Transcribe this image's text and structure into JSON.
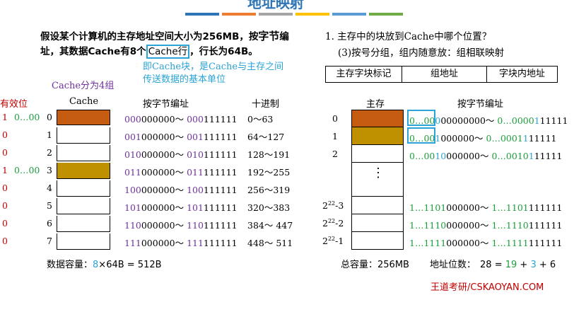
{
  "colors": {
    "brown": "#c55a11",
    "gold": "#bf9000",
    "red": "#c00000",
    "green": "#1a9e3a",
    "purple": "#7030a0",
    "blue": "#2aa3d6",
    "accent": "#2e75b6"
  },
  "slide_title": "地址映射",
  "question": {
    "line1_pre": "假设某个计算机的主存地址空间大小为256MB，按",
    "line1_bold": "字节",
    "line1_post": "编",
    "line2_pre": "址，其数据Cache有8个",
    "line2_box": "Cache行",
    "line2_post": "，行长为64B。"
  },
  "note": {
    "line1": "即Cache块，是Cache与主存之间",
    "line2": "传送数据的基本单位"
  },
  "groups_label": "Cache分为4组",
  "left_headers": {
    "valid": "有效位",
    "cache": "Cache",
    "addr": "按字节编址",
    "decimal": "十进制"
  },
  "cache_rows": [
    {
      "valid": "1",
      "tag": "0…00",
      "index": "0",
      "hi": "000",
      "lo": "000000",
      "hi2": "000",
      "lo2": "111111",
      "dec": "0～63"
    },
    {
      "valid": "0",
      "tag": "",
      "index": "1",
      "hi": "001",
      "lo": "000000",
      "hi2": "001",
      "lo2": "111111",
      "dec": "64～127"
    },
    {
      "valid": "0",
      "tag": "",
      "index": "2",
      "hi": "010",
      "lo": "000000",
      "hi2": "010",
      "lo2": "111111",
      "dec": "128～191"
    },
    {
      "valid": "1",
      "tag": "0…00",
      "index": "3",
      "hi": "011",
      "lo": "000000",
      "hi2": "011",
      "lo2": "111111",
      "dec": "192～255"
    },
    {
      "valid": "0",
      "tag": "",
      "index": "4",
      "hi": "100",
      "lo": "000000",
      "hi2": "100",
      "lo2": "111111",
      "dec": "256～319"
    },
    {
      "valid": "0",
      "tag": "",
      "index": "5",
      "hi": "101",
      "lo": "000000",
      "hi2": "101",
      "lo2": "111111",
      "dec": "320～383"
    },
    {
      "valid": "0",
      "tag": "",
      "index": "6",
      "hi": "110",
      "lo": "000000",
      "hi2": "110",
      "lo2": "111111",
      "dec": "384～ 447"
    },
    {
      "valid": "0",
      "tag": "",
      "index": "7",
      "hi": "111",
      "lo": "000000",
      "hi2": "111",
      "lo2": "111111",
      "dec": "448～ 511"
    }
  ],
  "capacity": {
    "label": "数据容量：",
    "num": "8",
    "rest": "×64B = 512B"
  },
  "right": {
    "q1": "1. 主存中的块放到Cache中哪个位置？",
    "q2": "(3)按号分组，组内随意放：组相联映射",
    "fields": [
      "主存字块标记",
      "组地址",
      "字块内地址"
    ],
    "mem_header": "主存",
    "addr_header": "按字节编址",
    "dots": "⋮",
    "rows": [
      {
        "idx_base": "0",
        "idx_exp": "",
        "idx_suffix": "",
        "g": "0…00",
        "p": "0",
        "m": "00000000～ ",
        "g2": "0…0000",
        "p2": "1",
        "m2": "11111"
      },
      {
        "idx_base": "1",
        "idx_exp": "",
        "idx_suffix": "",
        "g": "0…00",
        "p": "1",
        "m": "000000～ ",
        "g2": "0…0001",
        "p2": "1",
        "m2": "11111"
      },
      {
        "idx_base": "2",
        "idx_exp": "",
        "idx_suffix": "",
        "g": "0…00",
        "p": "10",
        "m": "000000～ ",
        "g2": "0…0010",
        "p2": "1",
        "m2": "11111"
      },
      {
        "idx_base": "2",
        "idx_exp": "22",
        "idx_suffix": "-3",
        "g": "1…1101",
        "p": "",
        "m": "000000～ ",
        "g2": "1…1101",
        "p2": "",
        "m2": "111111"
      },
      {
        "idx_base": "2",
        "idx_exp": "22",
        "idx_suffix": "-2",
        "g": "1…1110",
        "p": "",
        "m": "000000～ ",
        "g2": "1…1110",
        "p2": "",
        "m2": "111111"
      },
      {
        "idx_base": "2",
        "idx_exp": "22",
        "idx_suffix": "-1",
        "g": "1…1111",
        "p": "",
        "m": "000000～ ",
        "g2": "1…1111",
        "p2": "",
        "m2": "111111"
      }
    ],
    "total_label": "总容量：",
    "total_value": "256MB",
    "bits_label": "地址位数：",
    "bits_eq": "28 = ",
    "bits_a": "19",
    "bits_plus1": " + ",
    "bits_b": "3",
    "bits_plus2": " + 6"
  },
  "brand": "王道考研/CSKAOYAN.COM"
}
